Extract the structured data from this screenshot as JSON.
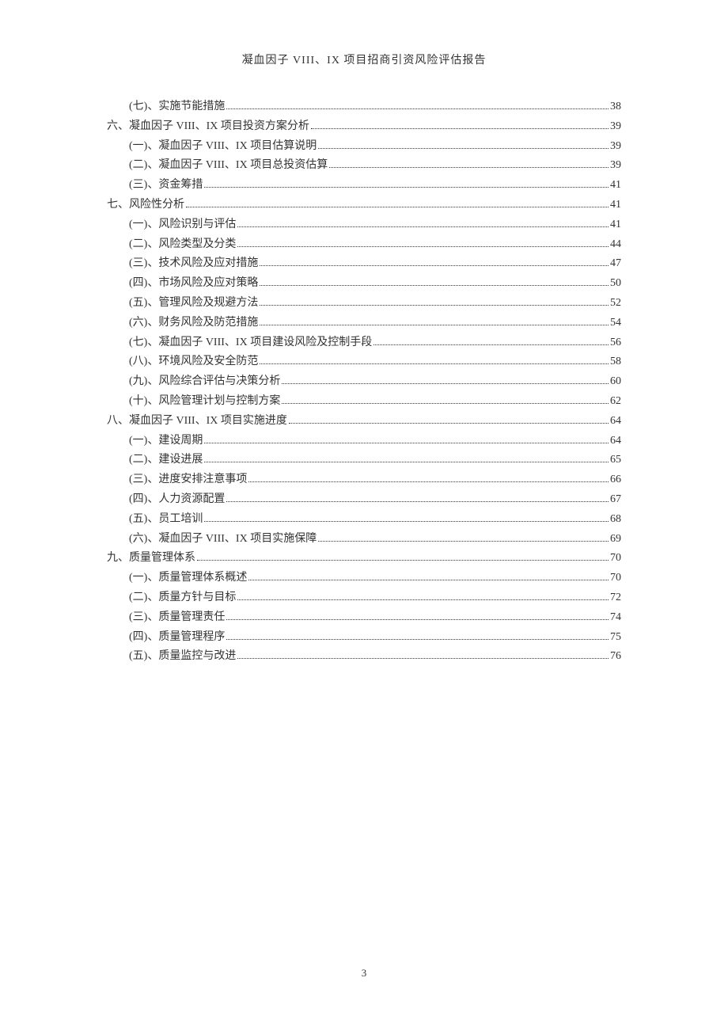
{
  "header": {
    "title": "凝血因子 VIII、IX 项目招商引资风险评估报告"
  },
  "toc": [
    {
      "level": 2,
      "label": "(七)、实施节能措施",
      "page": "38"
    },
    {
      "level": 1,
      "label": "六、凝血因子 VIII、IX 项目投资方案分析",
      "page": "39"
    },
    {
      "level": 2,
      "label": "(一)、凝血因子 VIII、IX 项目估算说明",
      "page": "39"
    },
    {
      "level": 2,
      "label": "(二)、凝血因子 VIII、IX 项目总投资估算",
      "page": "39"
    },
    {
      "level": 2,
      "label": "(三)、资金筹措",
      "page": "41"
    },
    {
      "level": 1,
      "label": "七、风险性分析",
      "page": "41"
    },
    {
      "level": 2,
      "label": "(一)、风险识别与评估",
      "page": "41"
    },
    {
      "level": 2,
      "label": "(二)、风险类型及分类",
      "page": "44"
    },
    {
      "level": 2,
      "label": "(三)、技术风险及应对措施",
      "page": "47"
    },
    {
      "level": 2,
      "label": "(四)、市场风险及应对策略",
      "page": "50"
    },
    {
      "level": 2,
      "label": "(五)、管理风险及规避方法",
      "page": "52"
    },
    {
      "level": 2,
      "label": "(六)、财务风险及防范措施",
      "page": "54"
    },
    {
      "level": 2,
      "label": "(七)、凝血因子 VIII、IX 项目建设风险及控制手段",
      "page": "56"
    },
    {
      "level": 2,
      "label": "(八)、环境风险及安全防范",
      "page": "58"
    },
    {
      "level": 2,
      "label": "(九)、风险综合评估与决策分析",
      "page": "60"
    },
    {
      "level": 2,
      "label": "(十)、风险管理计划与控制方案",
      "page": "62"
    },
    {
      "level": 1,
      "label": "八、凝血因子 VIII、IX 项目实施进度",
      "page": "64"
    },
    {
      "level": 2,
      "label": "(一)、建设周期",
      "page": "64"
    },
    {
      "level": 2,
      "label": "(二)、建设进展",
      "page": "65"
    },
    {
      "level": 2,
      "label": "(三)、进度安排注意事项",
      "page": "66"
    },
    {
      "level": 2,
      "label": "(四)、人力资源配置",
      "page": "67"
    },
    {
      "level": 2,
      "label": "(五)、员工培训",
      "page": "68"
    },
    {
      "level": 2,
      "label": "(六)、凝血因子 VIII、IX 项目实施保障",
      "page": "69"
    },
    {
      "level": 1,
      "label": "九、质量管理体系",
      "page": "70"
    },
    {
      "level": 2,
      "label": "(一)、质量管理体系概述",
      "page": "70"
    },
    {
      "level": 2,
      "label": "(二)、质量方针与目标",
      "page": "72"
    },
    {
      "level": 2,
      "label": "(三)、质量管理责任",
      "page": "74"
    },
    {
      "level": 2,
      "label": "(四)、质量管理程序",
      "page": "75"
    },
    {
      "level": 2,
      "label": "(五)、质量监控与改进",
      "page": "76"
    }
  ],
  "footer": {
    "page_number": "3"
  }
}
